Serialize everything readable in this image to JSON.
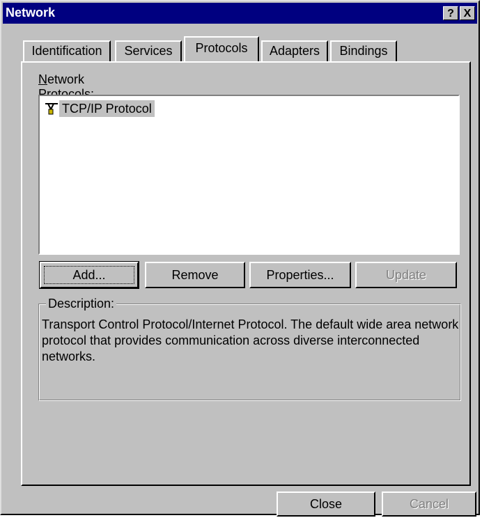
{
  "window": {
    "title": "Network",
    "help_button": "?",
    "close_button": "X"
  },
  "tabs": [
    {
      "label": "Identification",
      "active": false
    },
    {
      "label": "Services",
      "active": false
    },
    {
      "label": "Protocols",
      "active": true
    },
    {
      "label": "Adapters",
      "active": false
    },
    {
      "label": "Bindings",
      "active": false
    }
  ],
  "protocols": {
    "label": "Network Protocols:",
    "items": [
      {
        "label": "TCP/IP Protocol",
        "icon": "network-protocol-icon",
        "selected": true
      }
    ]
  },
  "buttons": {
    "add": "Add...",
    "remove": "Remove",
    "properties": "Properties...",
    "update": "Update"
  },
  "description": {
    "legend": "Description:",
    "text": "Transport Control Protocol/Internet Protocol. The default wide area network protocol that provides communication across diverse interconnected networks."
  },
  "footer": {
    "close": "Close",
    "cancel": "Cancel"
  },
  "colors": {
    "titlebar": "#000080",
    "face": "#c0c0c0"
  }
}
